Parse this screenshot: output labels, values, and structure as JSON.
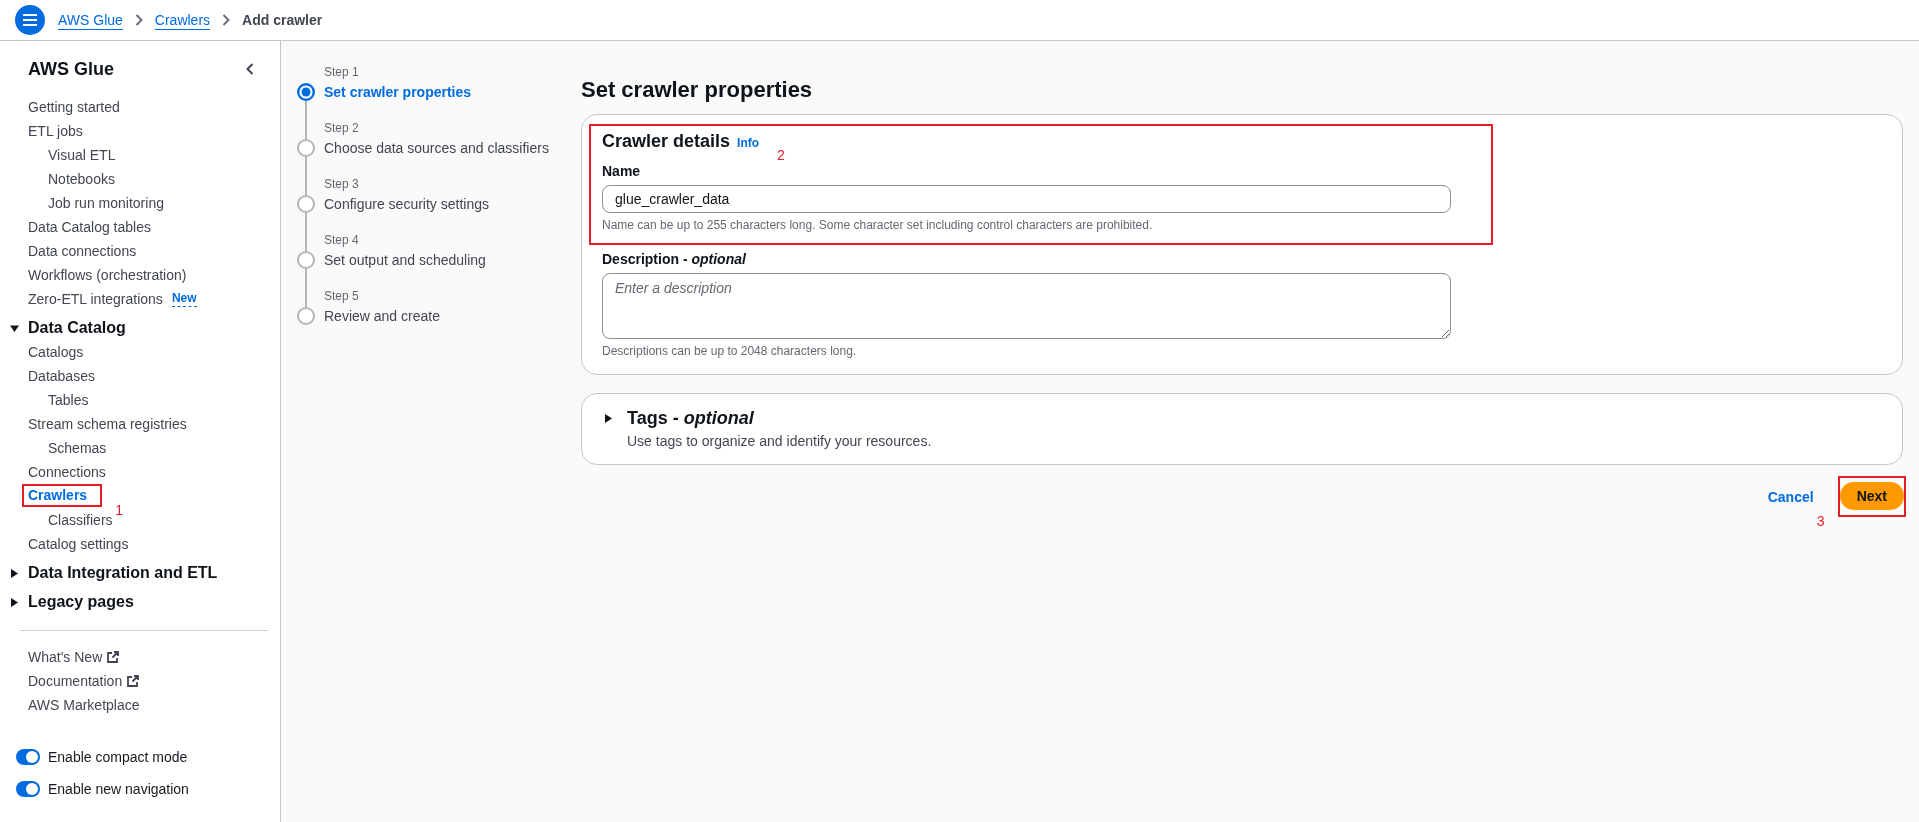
{
  "header": {
    "breadcrumbs": [
      {
        "label": "AWS Glue",
        "kind": "link"
      },
      {
        "label": "Crawlers",
        "kind": "link"
      },
      {
        "label": "Add crawler",
        "kind": "current"
      }
    ]
  },
  "sidebar": {
    "title": "AWS Glue",
    "items": [
      {
        "label": "Getting started",
        "selected": false
      },
      {
        "label": "ETL jobs",
        "selected": false,
        "children": [
          {
            "label": "Visual ETL",
            "selected": false
          },
          {
            "label": "Notebooks",
            "selected": false
          },
          {
            "label": "Job run monitoring",
            "selected": false
          }
        ]
      },
      {
        "label": "Data Catalog tables",
        "selected": false
      },
      {
        "label": "Data connections",
        "selected": false
      },
      {
        "label": "Workflows (orchestration)",
        "selected": false
      },
      {
        "label": "Zero-ETL integrations",
        "selected": false,
        "badge": "New"
      }
    ],
    "sections": [
      {
        "title": "Data Catalog",
        "expanded": true,
        "items": [
          {
            "label": "Catalogs",
            "selected": false
          },
          {
            "label": "Databases",
            "selected": false,
            "children": [
              {
                "label": "Tables",
                "selected": false
              }
            ]
          },
          {
            "label": "Stream schema registries",
            "selected": false,
            "children": [
              {
                "label": "Schemas",
                "selected": false
              }
            ]
          },
          {
            "label": "Connections",
            "selected": false
          },
          {
            "label": "Crawlers",
            "selected": true,
            "annotation": "1",
            "children": [
              {
                "label": "Classifiers",
                "selected": false
              }
            ]
          },
          {
            "label": "Catalog settings",
            "selected": false
          }
        ]
      },
      {
        "title": "Data Integration and ETL",
        "expanded": false
      },
      {
        "title": "Legacy pages",
        "expanded": false
      }
    ],
    "links": [
      {
        "label": "What's New",
        "external": true
      },
      {
        "label": "Documentation",
        "external": true
      },
      {
        "label": "AWS Marketplace",
        "external": false
      }
    ],
    "toggles": [
      {
        "label": "Enable compact mode",
        "on": true
      },
      {
        "label": "Enable new navigation",
        "on": true
      }
    ]
  },
  "steps": [
    {
      "label": "Step 1",
      "title": "Set crawler properties",
      "selected": true
    },
    {
      "label": "Step 2",
      "title": "Choose data sources and classifiers",
      "selected": false
    },
    {
      "label": "Step 3",
      "title": "Configure security settings",
      "selected": false
    },
    {
      "label": "Step 4",
      "title": "Set output and scheduling",
      "selected": false
    },
    {
      "label": "Step 5",
      "title": "Review and create",
      "selected": false
    }
  ],
  "page": {
    "title": "Set crawler properties",
    "details_card": {
      "crawler_details": {
        "annotation": "2",
        "heading": "Crawler details",
        "info_link": "Info",
        "field": {
          "label": "Name",
          "value": "glue_crawler_data",
          "hint": "Name can be up to 255 characters long. Some character set including control characters are prohibited."
        }
      },
      "description_field": {
        "label": "Description - *optional*",
        "placeholder": "Enter a description",
        "hint": "Descriptions can be up to 2048 characters long."
      }
    },
    "tags_card": {
      "title": "Tags - *optional*",
      "expanded": false,
      "description": "Use tags to organize and identify your resources."
    },
    "actions": [
      {
        "label": "Cancel",
        "kind": "link"
      },
      {
        "label": "Next",
        "kind": "primary",
        "annotation": "3"
      }
    ]
  }
}
